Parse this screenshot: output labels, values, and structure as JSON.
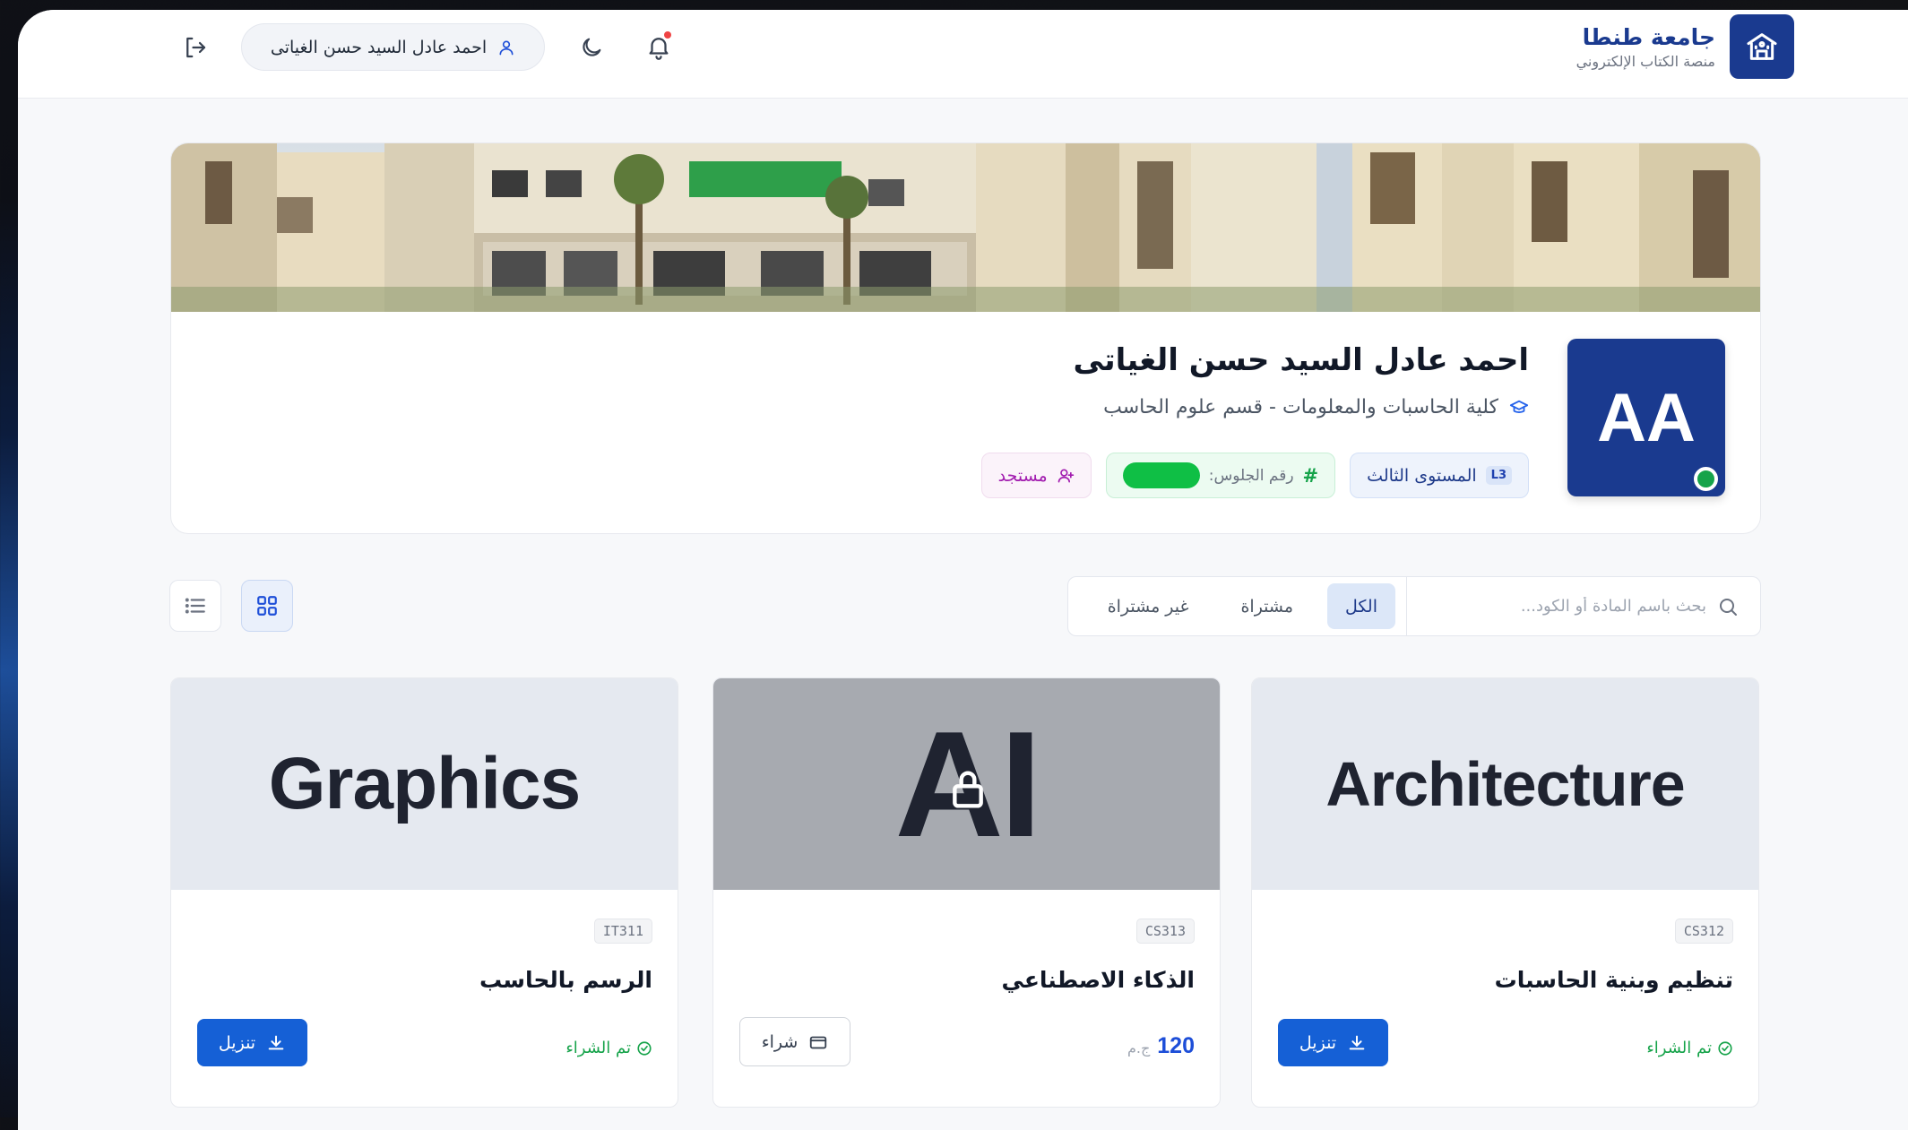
{
  "header": {
    "brand_name": "جامعة طنطا",
    "brand_subtitle": "منصة الكتاب الإلكتروني",
    "user_name": "احمد عادل السيد حسن الغياتى"
  },
  "profile": {
    "initials": "AA",
    "name": "احمد عادل السيد حسن الغياتى",
    "faculty": "كلية الحاسبات والمعلومات - قسم علوم الحاسب",
    "level_code": "L3",
    "level_label": "المستوى الثالث",
    "seat_label": "رقم الجلوس:",
    "status_label": "مستجد"
  },
  "toolbar": {
    "search_placeholder": "بحث باسم المادة أو الكود...",
    "filters": [
      "الكل",
      "مشتراة",
      "غير مشتراة"
    ],
    "active_filter": "الكل"
  },
  "books": [
    {
      "cover_text": "Architecture",
      "code": "CS312",
      "title": "تنظيم وبنية الحاسبات",
      "status": "تم الشراء",
      "action": "تنزيل"
    },
    {
      "cover_text": "AI",
      "code": "CS313",
      "title": "الذكاء الاصطناعي",
      "price": "120",
      "currency": "ج.م",
      "action": "شراء"
    },
    {
      "cover_text": "Graphics",
      "code": "IT311",
      "title": "الرسم بالحاسب",
      "status": "تم الشراء",
      "action": "تنزيل"
    }
  ],
  "colors": {
    "primary": "#1a3a8f",
    "button": "#1560d6",
    "success": "#16a34a",
    "danger": "#ef4444"
  }
}
